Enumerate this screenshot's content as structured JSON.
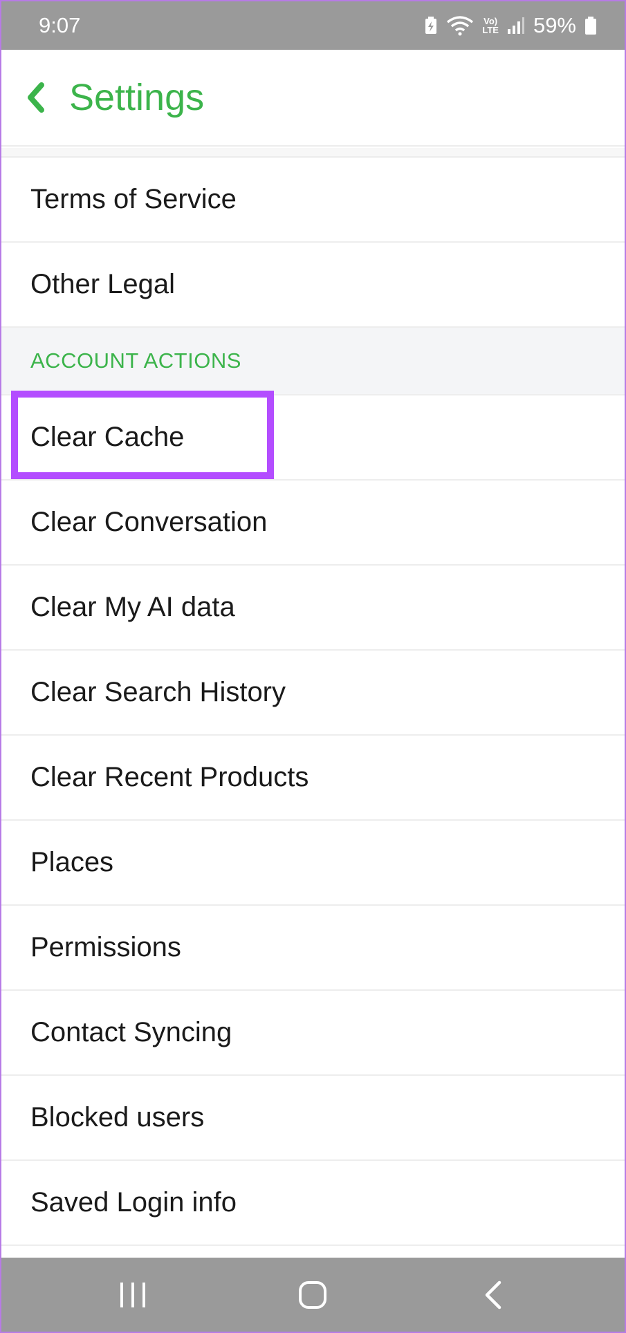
{
  "status_bar": {
    "time": "9:07",
    "network_label_top": "Vo)",
    "network_label_bottom": "LTE",
    "battery": "59%"
  },
  "header": {
    "title": "Settings",
    "back_icon": "chevron-left-icon"
  },
  "list_top": [
    "Terms of Service",
    "Other Legal"
  ],
  "section": {
    "title": "ACCOUNT ACTIONS"
  },
  "list_actions": [
    "Clear Cache",
    "Clear Conversation",
    "Clear My AI data",
    "Clear Search History",
    "Clear Recent Products",
    "Places",
    "Permissions",
    "Contact Syncing",
    "Blocked users",
    "Saved Login info"
  ],
  "colors": {
    "accent": "#3cb44b",
    "highlight": "#b34dff",
    "system_bar": "#9a9a9a"
  },
  "nav_icons": [
    "recents-icon",
    "home-icon",
    "back-icon"
  ]
}
